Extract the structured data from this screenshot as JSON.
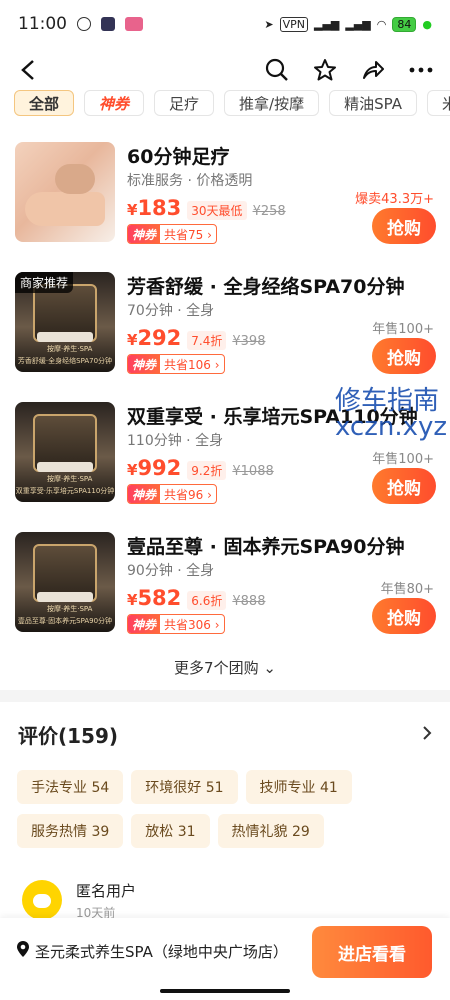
{
  "status": {
    "time": "11:00",
    "battery": "84",
    "vpn": "VPN"
  },
  "tabs": [
    {
      "label": "全部"
    },
    {
      "label": "神券"
    },
    {
      "label": "足疗"
    },
    {
      "label": "推拿/按摩"
    },
    {
      "label": "精油SPA"
    },
    {
      "label": "米"
    }
  ],
  "deals": [
    {
      "title": "60分钟足疗",
      "sub": "标准服务 · 价格透明",
      "yen": "¥",
      "price": "183",
      "discount": "30天最低",
      "original": "¥258",
      "coupon_tag": "神券",
      "coupon_save": "共省75 ›",
      "sold": "爆卖43.3万+",
      "buy": "抢购"
    },
    {
      "badge": "商家推荐",
      "thumb_caption": "芳香舒缓·全身经络SPA70分钟",
      "thumb_sign": "按摩·养生·SPA",
      "title": "芳香舒缓 · 全身经络SPA70分钟",
      "sub": "70分钟 · 全身",
      "yen": "¥",
      "price": "292",
      "discount": "7.4折",
      "original": "¥398",
      "coupon_tag": "神券",
      "coupon_save": "共省106 ›",
      "sold": "年售100+",
      "buy": "抢购"
    },
    {
      "thumb_caption": "双重享受·乐享培元SPA110分钟",
      "thumb_sign": "按摩·养生·SPA",
      "title": "双重享受 · 乐享培元SPA110分钟",
      "sub": "110分钟 · 全身",
      "yen": "¥",
      "price": "992",
      "discount": "9.2折",
      "original": "¥1088",
      "coupon_tag": "神券",
      "coupon_save": "共省96 ›",
      "sold": "年售100+",
      "buy": "抢购"
    },
    {
      "thumb_caption": "壹品至尊·固本养元SPA90分钟",
      "thumb_sign": "按摩·养生·SPA",
      "title": "壹品至尊 · 固本养元SPA90分钟",
      "sub": "90分钟 · 全身",
      "yen": "¥",
      "price": "582",
      "discount": "6.6折",
      "original": "¥888",
      "coupon_tag": "神券",
      "coupon_save": "共省306 ›",
      "sold": "年售80+",
      "buy": "抢购"
    }
  ],
  "more_groups": "更多7个团购 ⌄",
  "reviews": {
    "title": "评价(159)",
    "tags": [
      "手法专业 54",
      "环境很好 51",
      "技师专业 41",
      "服务热情 39",
      "放松 31",
      "热情礼貌 29"
    ],
    "user_name": "匿名用户",
    "user_date": "10天前"
  },
  "bottom": {
    "shop_name": "圣元柔式养生SPA（绿地中央广场店）",
    "enter_label": "进店看看"
  },
  "watermark": {
    "line1": "修车指南",
    "line2": "xczn.xyz"
  },
  "colors": {
    "accent": "#ff4d2d",
    "button_gradient": "#ff7a2d"
  }
}
